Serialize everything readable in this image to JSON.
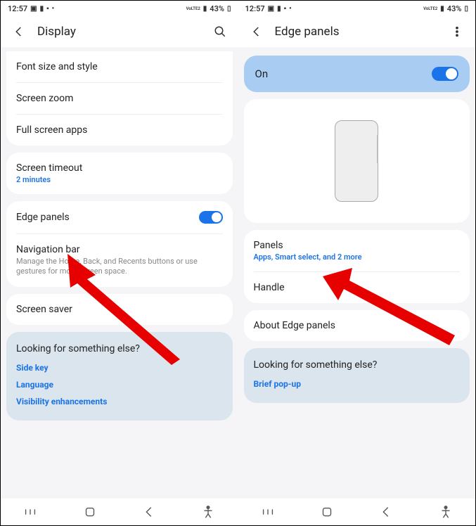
{
  "screen1": {
    "status": {
      "time": "12:57",
      "battery": "43%",
      "net": "VoLTE2"
    },
    "header": {
      "title": "Display"
    },
    "group1": {
      "font": "Font size and style",
      "zoom": "Screen zoom",
      "fullscreen": "Full screen apps"
    },
    "group2": {
      "timeout": "Screen timeout",
      "timeout_sub": "2 minutes"
    },
    "group3": {
      "edge": "Edge panels",
      "nav": "Navigation bar",
      "nav_desc": "Manage the Home, Back, and Recents buttons or use gestures for more screen space."
    },
    "group4": {
      "saver": "Screen saver"
    },
    "look": {
      "title": "Looking for something else?",
      "links": [
        "Side key",
        "Language",
        "Visibility enhancements"
      ]
    }
  },
  "screen2": {
    "status": {
      "time": "12:57",
      "battery": "43%",
      "net": "VoLTE2"
    },
    "header": {
      "title": "Edge panels"
    },
    "on": "On",
    "group1": {
      "panels": "Panels",
      "panels_sub": "Apps, Smart select, and 2 more",
      "handle": "Handle"
    },
    "group2": {
      "about": "About Edge panels"
    },
    "look": {
      "title": "Looking for something else?",
      "links": [
        "Brief pop-up"
      ]
    }
  }
}
